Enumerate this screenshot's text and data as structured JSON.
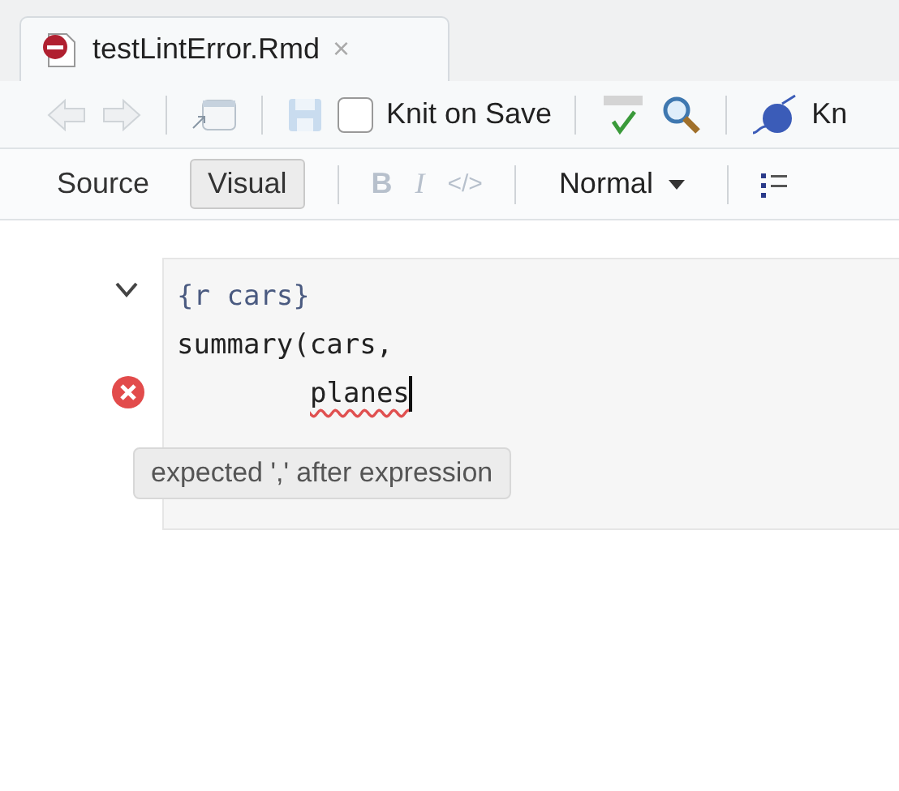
{
  "tab": {
    "title": "testLintError.Rmd",
    "close": "×"
  },
  "toolbar": {
    "knit_on_save": {
      "label": "Knit on Save",
      "checked": false
    },
    "knit_label": "Kn"
  },
  "mode_bar": {
    "modes": [
      {
        "label": "Source",
        "selected": false
      },
      {
        "label": "Visual",
        "selected": true
      }
    ],
    "format": {
      "bold": "B",
      "italic": "I",
      "code": "</>",
      "style": "Normal"
    }
  },
  "chunk": {
    "expanded": true,
    "header": "{r cars}",
    "lines": [
      {
        "text": "summary(cars,",
        "error": false,
        "indented": false
      },
      {
        "text": "planes",
        "error": true,
        "indented": true
      }
    ],
    "tooltip": "expected ',' after expression"
  }
}
